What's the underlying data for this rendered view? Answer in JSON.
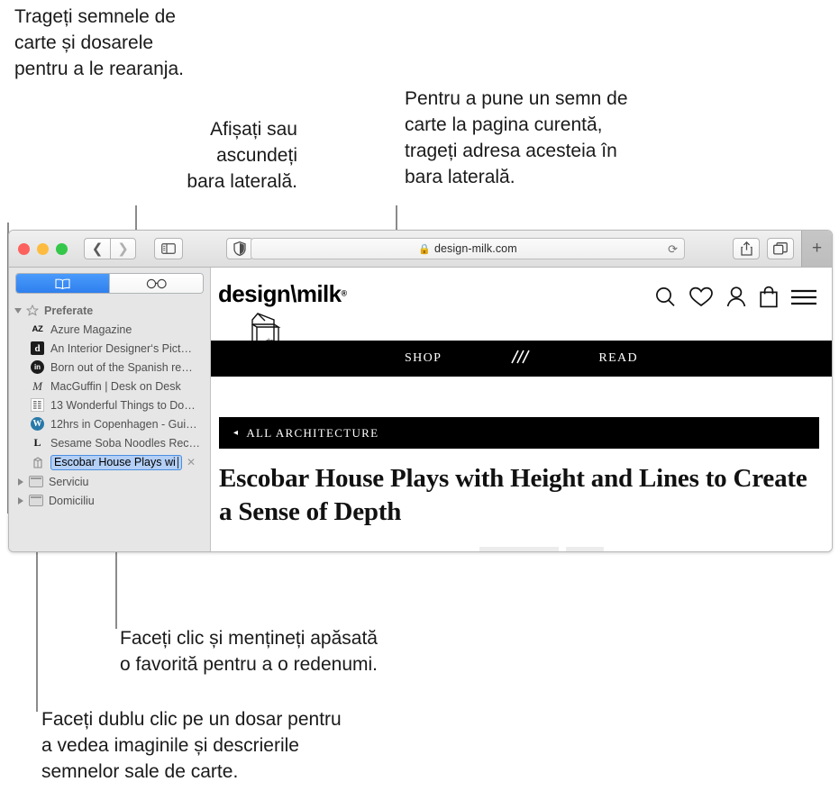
{
  "callouts": {
    "drag_rearrange": "Trageți semnele de\ncarte și dosarele\npentru a le rearanja.",
    "show_hide_sidebar": "Afișați sau\nascundeți\nbara laterală.",
    "add_bookmark": "Pentru a pune un semn de\ncarte la pagina curentă,\ntrageți adresa acesteia în\nbara laterală.",
    "rename_favorite": "Faceți clic și mențineți apăsată\no favorită pentru a o redenumi.",
    "double_click_folder": "Faceți dublu clic pe un dosar pentru\na vedea imaginile și descrierile\nsemnelor sale de carte."
  },
  "browser": {
    "address": {
      "url": "design-milk.com",
      "lock_icon": "lock-icon",
      "reload_icon": "reload-icon"
    },
    "buttons": {
      "back_icon": "back-chevron-icon",
      "forward_icon": "forward-chevron-icon",
      "sidebar_toggle_icon": "sidebar-toggle-icon",
      "privacy_icon": "privacy-shield-icon",
      "reader_icon": "reader-view-icon",
      "share_icon": "share-icon",
      "tab_overview_icon": "tab-overview-icon",
      "new_tab_icon": "plus-icon"
    },
    "traffic_lights": {
      "close": "#fc615d",
      "minimize": "#fdbc40",
      "zoom": "#34c749"
    }
  },
  "sidebar": {
    "segments": [
      {
        "name": "bookmarks",
        "icon": "book-icon",
        "selected": true
      },
      {
        "name": "reading-list",
        "icon": "glasses-icon",
        "selected": false
      }
    ],
    "group": {
      "label": "Preferate",
      "icon": "star-icon"
    },
    "bookmarks": [
      {
        "favicon": "AZ",
        "label": "Azure Magazine",
        "style": "az"
      },
      {
        "favicon": "d",
        "label": "An Interior Designer‘s Pict…",
        "style": "dblack"
      },
      {
        "favicon": "in",
        "label": "Born out of the Spanish re…",
        "style": "circle"
      },
      {
        "favicon": "M",
        "label": "MacGuffin | Desk on Desk",
        "style": "italicm"
      },
      {
        "favicon": "▤",
        "label": "13 Wonderful Things to Do…",
        "style": "grid"
      },
      {
        "favicon": "W",
        "label": "12hrs in Copenhagen - Gui…",
        "style": "wordpress"
      },
      {
        "favicon": "L",
        "label": "Sesame Soba Noodles Rec…",
        "style": "serifL"
      }
    ],
    "editing_bookmark": {
      "favicon": "milk-carton-icon",
      "text": "Escobar House Plays with",
      "clear_icon": "clear-x-icon"
    },
    "folders": [
      {
        "label": "Serviciu",
        "icon": "folder-icon"
      },
      {
        "label": "Domiciliu",
        "icon": "folder-icon"
      }
    ]
  },
  "page": {
    "logo": {
      "text_left": "design",
      "slash": "\\",
      "text_right": "milk",
      "registered": "®",
      "carton_label": "dm"
    },
    "header_icons": [
      {
        "name": "search-icon"
      },
      {
        "name": "heart-icon"
      },
      {
        "name": "account-icon"
      },
      {
        "name": "bag-icon"
      },
      {
        "name": "menu-icon"
      }
    ],
    "nav": [
      {
        "label": "SHOP"
      },
      {
        "label": "",
        "icon": "slashes-logo-icon"
      },
      {
        "label": "READ"
      }
    ],
    "category_bar": {
      "arrow": "◂",
      "label": "ALL ARCHITECTURE"
    },
    "headline": "Escobar House Plays with Height and Lines to Create a Sense of Depth"
  }
}
